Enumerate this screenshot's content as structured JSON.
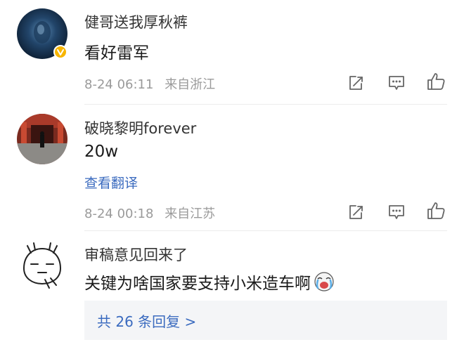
{
  "comments": [
    {
      "username": "健哥送我厚秋裤",
      "text": "看好雷军",
      "date": "8-24 06:11",
      "location": "来自浙江",
      "verified": true
    },
    {
      "username": "破晓黎明forever",
      "text": "20w",
      "translate_label": "查看翻译",
      "date": "8-24 00:18",
      "location": "来自江苏"
    },
    {
      "username": "审稿意见回来了",
      "text": "关键为啥国家要支持小米造车啊"
    }
  ],
  "replies_label": "共 26 条回复 >",
  "icons": [
    "share-icon",
    "comment-icon",
    "like-icon",
    "verified-badge-icon",
    "laughing-crying-emoji-icon"
  ],
  "colors": {
    "link": "#3b6bbf",
    "meta": "#9a9a9a",
    "verified": "#f7b500",
    "reply_bg": "#f4f5f7"
  }
}
